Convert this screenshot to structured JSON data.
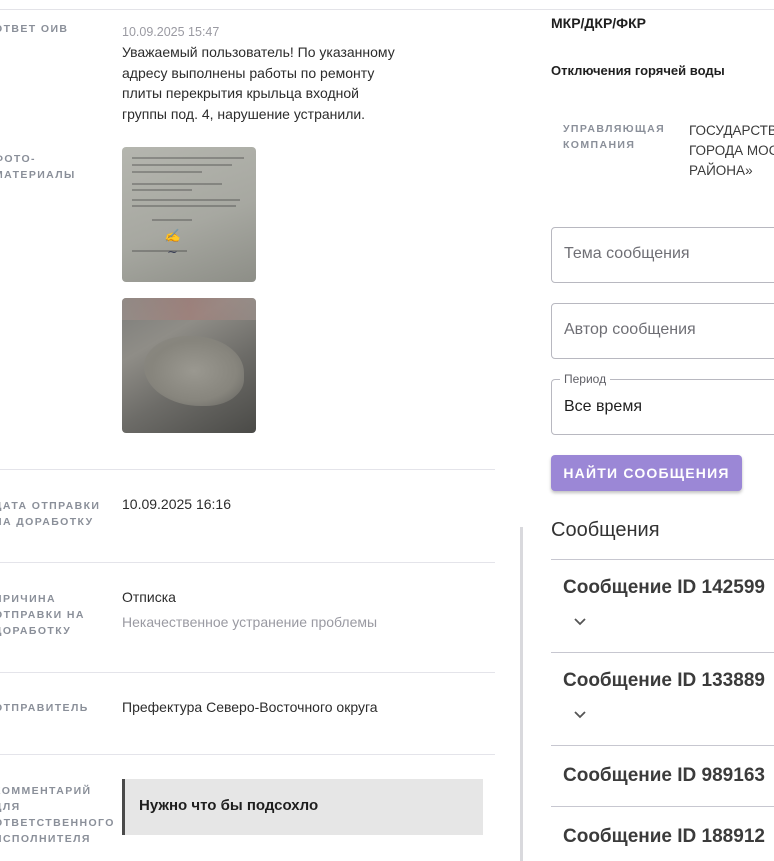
{
  "left": {
    "oiv_reply": {
      "label": "ответ ОИВ",
      "timestamp": "10.09.2025 15:47",
      "text_lines": [
        "Уважаемый пользователь! По указанному",
        "адресу выполнены работы по ремонту",
        "плиты перекрытия крыльца входной",
        "группы под. 4, нарушение устранили."
      ]
    },
    "photos": {
      "label_lines": [
        "фото-",
        "материалы"
      ]
    },
    "send_date": {
      "label_lines": [
        "дата отправки",
        "на доработку"
      ],
      "value": "10.09.2025 16:16"
    },
    "reason": {
      "label_lines": [
        "причина",
        "отправки на",
        "доработку"
      ],
      "value": "Отписка",
      "detail": "Некачественное устранение проблемы"
    },
    "sender": {
      "label": "отправитель",
      "value": "Префектура Северо-Восточного округа"
    },
    "comment": {
      "label_lines": [
        "комментарий",
        "для",
        "ответственного",
        "исполнителя"
      ],
      "value": "Нужно что бы подсохло"
    }
  },
  "right": {
    "category": "МКР/ДКР/ФКР",
    "subcategory": "Отключения горячей воды",
    "management_company": {
      "label_lines": [
        "управляющая",
        "компания"
      ],
      "value_lines": [
        "ГОСУДАРСТВ",
        "ГОРОДА МОС",
        "РАЙОНА»"
      ]
    },
    "filters": {
      "topic_placeholder": "Тема сообщения",
      "author_placeholder": "Автор сообщения",
      "period_label": "Период",
      "period_value": "Все время"
    },
    "search_button": "НАЙТИ СООБЩЕНИЯ",
    "messages_title": "Сообщения",
    "messages": [
      "Сообщение ID 142599",
      "Сообщение ID 133889",
      "Сообщение ID 989163",
      "Сообщение ID 188912"
    ]
  }
}
